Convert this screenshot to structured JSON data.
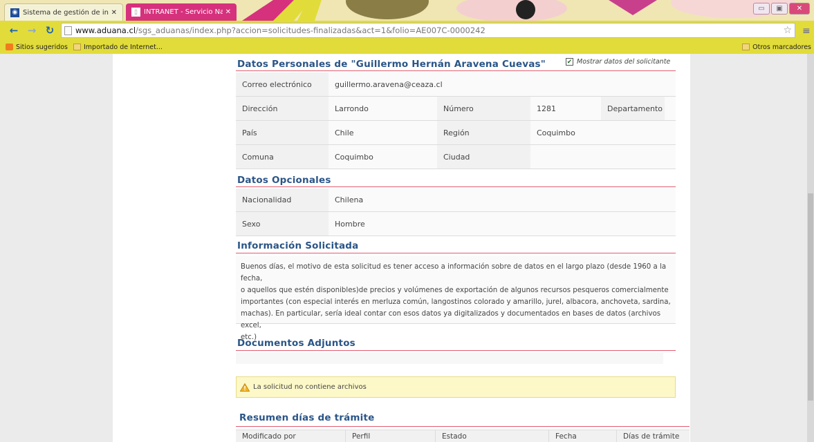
{
  "browser": {
    "tabs": [
      {
        "title": "Sistema de gestión de inform",
        "active": true
      },
      {
        "title": "INTRANET - Servicio Naciona",
        "active": false
      }
    ],
    "address": {
      "host": "www.aduana.cl",
      "path": "/sgs_aduanas/index.php?accion=solicitudes-finalizadas&act=1&folio=AE007C-0000242"
    },
    "bookmarks": {
      "suggested": "Sitios sugeridos",
      "imported": "Importado de Internet...",
      "other": "Otros marcadores"
    }
  },
  "personal": {
    "title": "Datos Personales de \"Guillermo Hernán Aravena Cuevas\"",
    "show_checkbox_label": "Mostrar datos del solicitante",
    "email_label": "Correo electrónico",
    "email_value": "guillermo.aravena@ceaza.cl",
    "address_label": "Dirección",
    "address_value": "Larrondo",
    "number_label": "Número",
    "number_value": "1281",
    "dept_label": "Departamento",
    "dept_value": "",
    "country_label": "País",
    "country_value": "Chile",
    "region_label": "Región",
    "region_value": "Coquimbo",
    "commune_label": "Comuna",
    "commune_value": "Coquimbo",
    "city_label": "Ciudad",
    "city_value": ""
  },
  "optional": {
    "title": "Datos Opcionales",
    "nationality_label": "Nacionalidad",
    "nationality_value": "Chilena",
    "sex_label": "Sexo",
    "sex_value": "Hombre"
  },
  "request": {
    "title": "Información Solicitada",
    "lines": [
      "Buenos días, el motivo de esta solicitud es tener acceso a información sobre de datos en el largo plazo (desde 1960 a la fecha,",
      "o aquellos que estén disponibles)de precios y volúmenes de exportación de algunos recursos pesqueros comercialmente",
      "importantes (con especial interés en merluza común, langostinos colorado y amarillo, jurel, albacora, anchoveta, sardina,",
      "machas). En particular, sería ideal contar con esos datos ya digitalizados y documentados en bases de datos (archivos excel,",
      "etc.)"
    ]
  },
  "documents": {
    "title": "Documentos Adjuntos",
    "alert": "La solicitud no contiene archivos"
  },
  "summary": {
    "title": "Resumen días de trámite",
    "columns": [
      "Modificado por",
      "Perfil",
      "Estado",
      "Fecha",
      "Días de trámite"
    ]
  },
  "colors": {
    "accent_title": "#2a5588",
    "section_rule": "#e35b6e",
    "browser_frame": "#e2dc3a",
    "alert_bg": "#fcf8c8"
  }
}
